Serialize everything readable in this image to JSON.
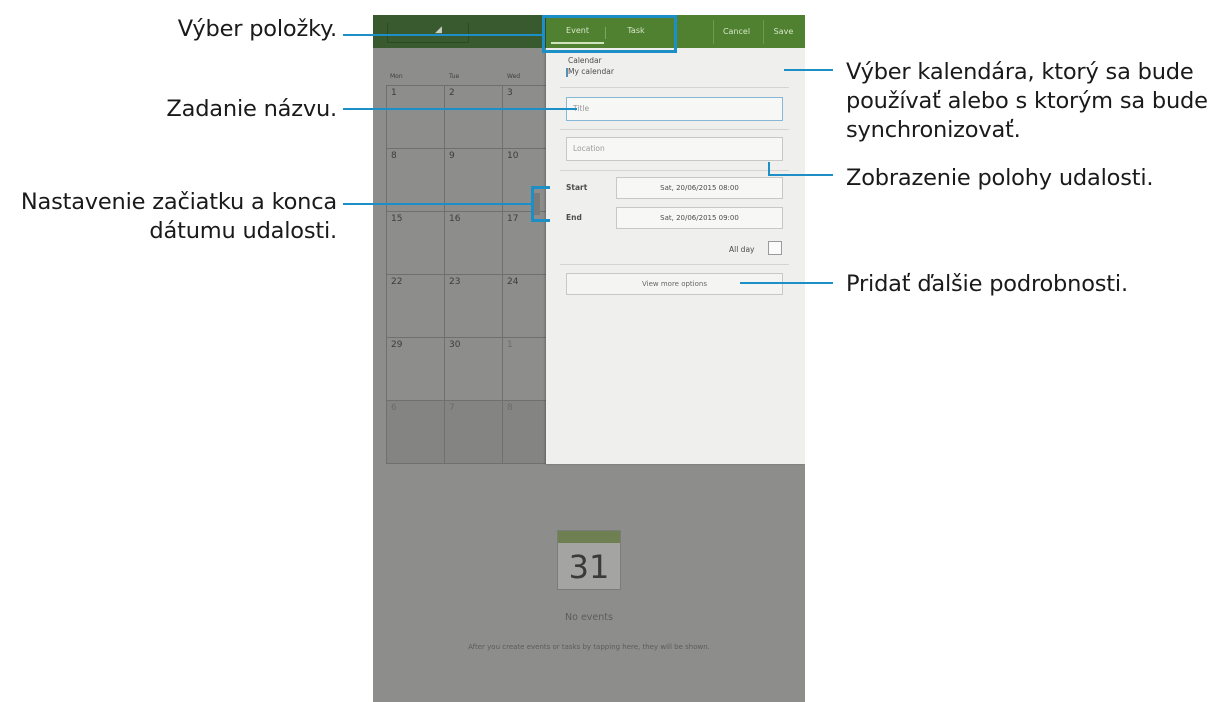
{
  "annotations": {
    "item_selection": "Výber položky.",
    "enter_title": "Zadanie názvu.",
    "set_start_end": [
      "Nastavenie začiatku a konca",
      "dátumu udalosti."
    ],
    "select_calendar": [
      "Výber kalendára, ktorý sa bude",
      "používať alebo s ktorým sa bude",
      "synchronizovať."
    ],
    "show_location": "Zobrazenie polohy udalosti.",
    "add_details": "Pridať ďalšie podrobnosti."
  },
  "calendar": {
    "weekdays": [
      "Mon",
      "Tue",
      "Wed"
    ],
    "weeks": [
      {
        "days": [
          "1",
          "2",
          "3"
        ],
        "dim": false
      },
      {
        "days": [
          "8",
          "9",
          "10"
        ],
        "dim": false
      },
      {
        "days": [
          "15",
          "16",
          "17"
        ],
        "dim": false
      },
      {
        "days": [
          "22",
          "23",
          "24"
        ],
        "dim": false
      },
      {
        "days": [
          "29",
          "30",
          "1"
        ],
        "dim": false
      },
      {
        "days": [
          "6",
          "7",
          "8"
        ],
        "dim": true
      }
    ],
    "day_number": "31",
    "no_events": "No events",
    "hint": "After you create events or tasks by tapping here, they will be shown."
  },
  "dialog": {
    "tabs": [
      "Event",
      "Task"
    ],
    "cancel": "Cancel",
    "save": "Save",
    "calendar_label": "Calendar",
    "calendar_value": "My calendar",
    "title_placeholder": "Title",
    "location_placeholder": "Location",
    "start_label": "Start",
    "start_value": "Sat, 20/06/2015  08:00",
    "end_label": "End",
    "end_value": "Sat, 20/06/2015  09:00",
    "all_day": "All day",
    "all_day_checked": false,
    "more_options": "View more options"
  },
  "colors": {
    "annotation_line": "#1c8fc7",
    "dialog_header": "#4f8131",
    "app_header": "#39592f"
  }
}
